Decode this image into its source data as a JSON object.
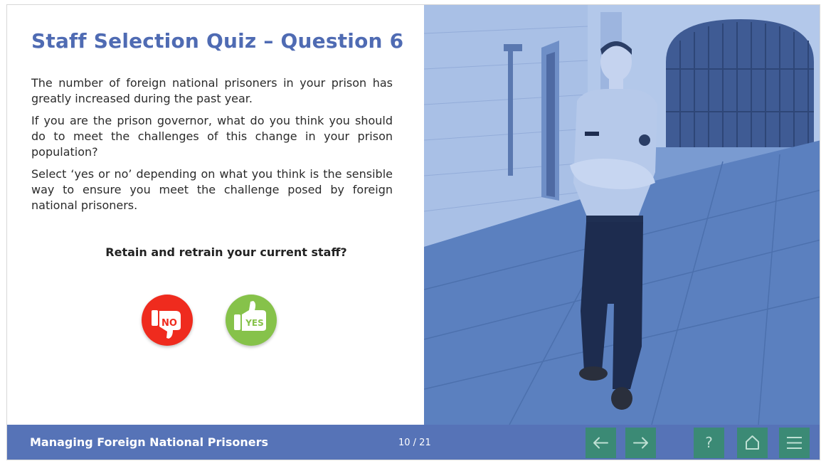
{
  "slide": {
    "title": "Staff Selection Quiz – Question 6",
    "paragraphs": [
      "The number of foreign national prisoners in your prison has greatly increased during the past year.",
      "If you are the prison governor, what do you think you should do to meet the challenges of this change in your prison population?",
      "Select ‘yes or no’ depending on what you think is the sensible way to ensure you meet the challenge posed by foreign national prisoners."
    ],
    "question": "Retain and retrain your current staff?",
    "answers": {
      "no_label": "NO",
      "yes_label": "YES",
      "no_icon": "thumbs-down-icon",
      "yes_icon": "thumbs-up-icon"
    },
    "image": "prison-officer-photo"
  },
  "footer": {
    "course_title": "Managing Foreign National Prisoners",
    "page_count": "10 / 21",
    "help_label": "?"
  },
  "colors": {
    "title": "#4f6bb3",
    "footer_bg": "#5673b7",
    "nav_button_bg": "#3b8a75",
    "no_button": "#ef2b1e",
    "yes_button": "#86c24a",
    "photo_tint": "#5f86c4"
  }
}
